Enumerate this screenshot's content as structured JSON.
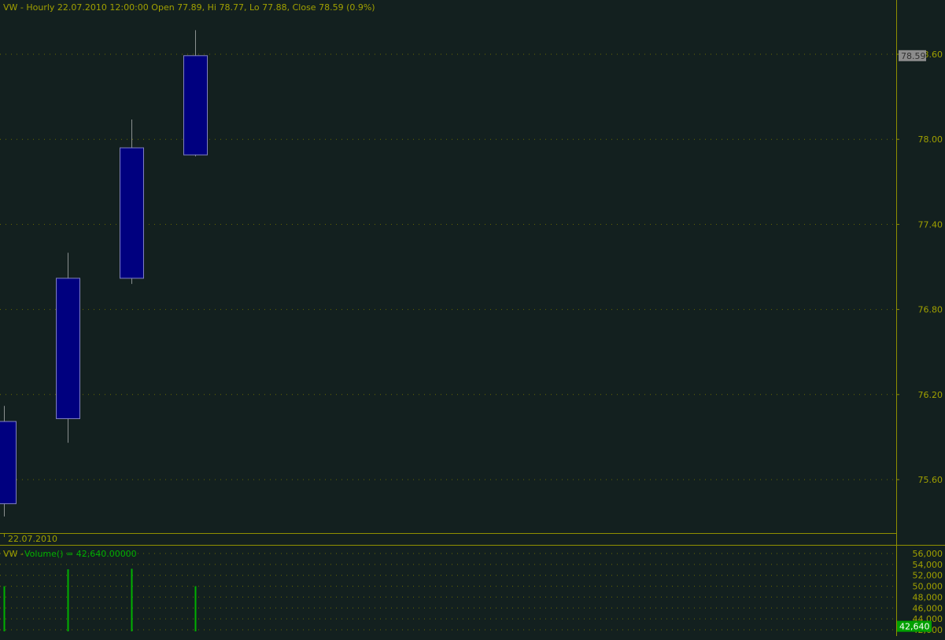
{
  "header": {
    "symbol": "VW",
    "interval": "Hourly",
    "datetime": "22.07.2010 12:00:00",
    "title_text": "VW - Hourly 22.07.2010 12:00:00 Open 77.89, Hi 78.77, Lo 77.88, Close 78.59 (0.9%)"
  },
  "price_axis": {
    "ticks": [
      "78.60",
      "78.00",
      "77.40",
      "76.80",
      "76.20",
      "75.60"
    ],
    "current_label": "78.59"
  },
  "date_label": "22.07.2010",
  "volume_panel": {
    "prefix": "VW - ",
    "indicator": "Volume() = 42,640.00000",
    "ticks": [
      "56,000",
      "54,000",
      "52,000",
      "50,000",
      "48,000",
      "46,000",
      "44,000",
      "42,000"
    ],
    "current_label": "42,640"
  },
  "colors": {
    "background": "#13201f",
    "candle_body": "#00007f",
    "candle_border": "#8080c0",
    "wick": "#8a9090",
    "grid_dot": "#6a6a00",
    "axis_line": "#909000",
    "text": "#a0a000",
    "volume_bar": "#00b000",
    "current_price_bg": "#8c8c8c",
    "current_volume_bg": "#00a000"
  },
  "chart_data": {
    "type": "candlestick",
    "title": "VW - Hourly 22.07.2010 12:00:00 Open 77.89, Hi 78.77, Lo 77.88, Close 78.59 (0.9%)",
    "ylim": [
      75.2,
      79.4
    ],
    "yticks": [
      75.6,
      76.2,
      76.8,
      77.4,
      78.0,
      78.6
    ],
    "candles": [
      {
        "open": 75.43,
        "high": 76.12,
        "low": 75.34,
        "close": 76.01
      },
      {
        "open": 76.03,
        "high": 77.2,
        "low": 75.86,
        "close": 77.02
      },
      {
        "open": 77.02,
        "high": 78.14,
        "low": 76.98,
        "close": 77.94
      },
      {
        "open": 77.89,
        "high": 78.77,
        "low": 77.88,
        "close": 78.59
      }
    ],
    "volume": {
      "values": [
        50000,
        53100,
        53200,
        50000
      ],
      "ylim": [
        41500,
        57000
      ],
      "yticks": [
        42000,
        44000,
        46000,
        48000,
        50000,
        52000,
        54000,
        56000
      ]
    }
  }
}
